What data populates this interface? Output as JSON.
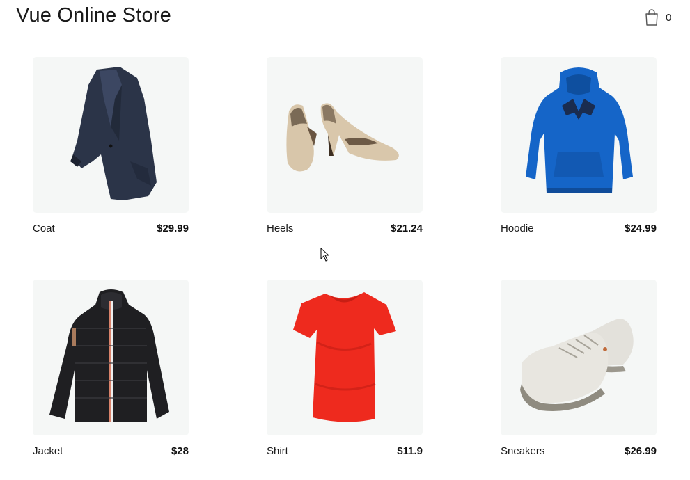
{
  "header": {
    "title": "Vue Online Store",
    "cart_count": "0"
  },
  "products": [
    {
      "name": "Coat",
      "price": "$29.99",
      "image_icon": "coat-image"
    },
    {
      "name": "Heels",
      "price": "$21.24",
      "image_icon": "heels-image"
    },
    {
      "name": "Hoodie",
      "price": "$24.99",
      "image_icon": "hoodie-image"
    },
    {
      "name": "Jacket",
      "price": "$28",
      "image_icon": "jacket-image"
    },
    {
      "name": "Shirt",
      "price": "$11.9",
      "image_icon": "shirt-image"
    },
    {
      "name": "Sneakers",
      "price": "$26.99",
      "image_icon": "sneakers-image"
    }
  ],
  "colors": {
    "card_bg": "#f5f7f6",
    "coat": "#2b3448",
    "hoodie": "#1565c8",
    "shirt": "#ee2a1e",
    "jacket": "#1f1f22",
    "heels": "#d8c6aa",
    "sneakers": "#e3e1db"
  }
}
